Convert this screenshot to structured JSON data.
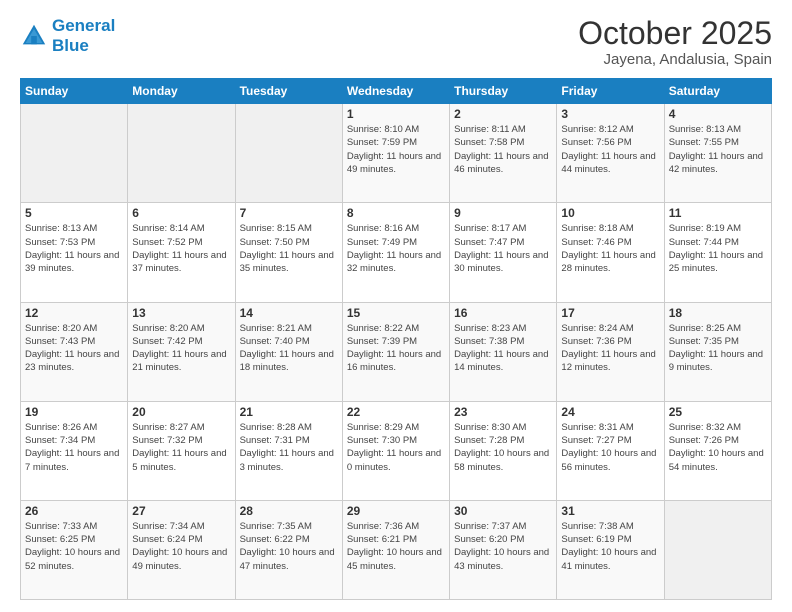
{
  "logo": {
    "line1": "General",
    "line2": "Blue"
  },
  "title": "October 2025",
  "subtitle": "Jayena, Andalusia, Spain",
  "days_of_week": [
    "Sunday",
    "Monday",
    "Tuesday",
    "Wednesday",
    "Thursday",
    "Friday",
    "Saturday"
  ],
  "weeks": [
    [
      {
        "day": "",
        "sunrise": "",
        "sunset": "",
        "daylight": ""
      },
      {
        "day": "",
        "sunrise": "",
        "sunset": "",
        "daylight": ""
      },
      {
        "day": "",
        "sunrise": "",
        "sunset": "",
        "daylight": ""
      },
      {
        "day": "1",
        "sunrise": "Sunrise: 8:10 AM",
        "sunset": "Sunset: 7:59 PM",
        "daylight": "Daylight: 11 hours and 49 minutes."
      },
      {
        "day": "2",
        "sunrise": "Sunrise: 8:11 AM",
        "sunset": "Sunset: 7:58 PM",
        "daylight": "Daylight: 11 hours and 46 minutes."
      },
      {
        "day": "3",
        "sunrise": "Sunrise: 8:12 AM",
        "sunset": "Sunset: 7:56 PM",
        "daylight": "Daylight: 11 hours and 44 minutes."
      },
      {
        "day": "4",
        "sunrise": "Sunrise: 8:13 AM",
        "sunset": "Sunset: 7:55 PM",
        "daylight": "Daylight: 11 hours and 42 minutes."
      }
    ],
    [
      {
        "day": "5",
        "sunrise": "Sunrise: 8:13 AM",
        "sunset": "Sunset: 7:53 PM",
        "daylight": "Daylight: 11 hours and 39 minutes."
      },
      {
        "day": "6",
        "sunrise": "Sunrise: 8:14 AM",
        "sunset": "Sunset: 7:52 PM",
        "daylight": "Daylight: 11 hours and 37 minutes."
      },
      {
        "day": "7",
        "sunrise": "Sunrise: 8:15 AM",
        "sunset": "Sunset: 7:50 PM",
        "daylight": "Daylight: 11 hours and 35 minutes."
      },
      {
        "day": "8",
        "sunrise": "Sunrise: 8:16 AM",
        "sunset": "Sunset: 7:49 PM",
        "daylight": "Daylight: 11 hours and 32 minutes."
      },
      {
        "day": "9",
        "sunrise": "Sunrise: 8:17 AM",
        "sunset": "Sunset: 7:47 PM",
        "daylight": "Daylight: 11 hours and 30 minutes."
      },
      {
        "day": "10",
        "sunrise": "Sunrise: 8:18 AM",
        "sunset": "Sunset: 7:46 PM",
        "daylight": "Daylight: 11 hours and 28 minutes."
      },
      {
        "day": "11",
        "sunrise": "Sunrise: 8:19 AM",
        "sunset": "Sunset: 7:44 PM",
        "daylight": "Daylight: 11 hours and 25 minutes."
      }
    ],
    [
      {
        "day": "12",
        "sunrise": "Sunrise: 8:20 AM",
        "sunset": "Sunset: 7:43 PM",
        "daylight": "Daylight: 11 hours and 23 minutes."
      },
      {
        "day": "13",
        "sunrise": "Sunrise: 8:20 AM",
        "sunset": "Sunset: 7:42 PM",
        "daylight": "Daylight: 11 hours and 21 minutes."
      },
      {
        "day": "14",
        "sunrise": "Sunrise: 8:21 AM",
        "sunset": "Sunset: 7:40 PM",
        "daylight": "Daylight: 11 hours and 18 minutes."
      },
      {
        "day": "15",
        "sunrise": "Sunrise: 8:22 AM",
        "sunset": "Sunset: 7:39 PM",
        "daylight": "Daylight: 11 hours and 16 minutes."
      },
      {
        "day": "16",
        "sunrise": "Sunrise: 8:23 AM",
        "sunset": "Sunset: 7:38 PM",
        "daylight": "Daylight: 11 hours and 14 minutes."
      },
      {
        "day": "17",
        "sunrise": "Sunrise: 8:24 AM",
        "sunset": "Sunset: 7:36 PM",
        "daylight": "Daylight: 11 hours and 12 minutes."
      },
      {
        "day": "18",
        "sunrise": "Sunrise: 8:25 AM",
        "sunset": "Sunset: 7:35 PM",
        "daylight": "Daylight: 11 hours and 9 minutes."
      }
    ],
    [
      {
        "day": "19",
        "sunrise": "Sunrise: 8:26 AM",
        "sunset": "Sunset: 7:34 PM",
        "daylight": "Daylight: 11 hours and 7 minutes."
      },
      {
        "day": "20",
        "sunrise": "Sunrise: 8:27 AM",
        "sunset": "Sunset: 7:32 PM",
        "daylight": "Daylight: 11 hours and 5 minutes."
      },
      {
        "day": "21",
        "sunrise": "Sunrise: 8:28 AM",
        "sunset": "Sunset: 7:31 PM",
        "daylight": "Daylight: 11 hours and 3 minutes."
      },
      {
        "day": "22",
        "sunrise": "Sunrise: 8:29 AM",
        "sunset": "Sunset: 7:30 PM",
        "daylight": "Daylight: 11 hours and 0 minutes."
      },
      {
        "day": "23",
        "sunrise": "Sunrise: 8:30 AM",
        "sunset": "Sunset: 7:28 PM",
        "daylight": "Daylight: 10 hours and 58 minutes."
      },
      {
        "day": "24",
        "sunrise": "Sunrise: 8:31 AM",
        "sunset": "Sunset: 7:27 PM",
        "daylight": "Daylight: 10 hours and 56 minutes."
      },
      {
        "day": "25",
        "sunrise": "Sunrise: 8:32 AM",
        "sunset": "Sunset: 7:26 PM",
        "daylight": "Daylight: 10 hours and 54 minutes."
      }
    ],
    [
      {
        "day": "26",
        "sunrise": "Sunrise: 7:33 AM",
        "sunset": "Sunset: 6:25 PM",
        "daylight": "Daylight: 10 hours and 52 minutes."
      },
      {
        "day": "27",
        "sunrise": "Sunrise: 7:34 AM",
        "sunset": "Sunset: 6:24 PM",
        "daylight": "Daylight: 10 hours and 49 minutes."
      },
      {
        "day": "28",
        "sunrise": "Sunrise: 7:35 AM",
        "sunset": "Sunset: 6:22 PM",
        "daylight": "Daylight: 10 hours and 47 minutes."
      },
      {
        "day": "29",
        "sunrise": "Sunrise: 7:36 AM",
        "sunset": "Sunset: 6:21 PM",
        "daylight": "Daylight: 10 hours and 45 minutes."
      },
      {
        "day": "30",
        "sunrise": "Sunrise: 7:37 AM",
        "sunset": "Sunset: 6:20 PM",
        "daylight": "Daylight: 10 hours and 43 minutes."
      },
      {
        "day": "31",
        "sunrise": "Sunrise: 7:38 AM",
        "sunset": "Sunset: 6:19 PM",
        "daylight": "Daylight: 10 hours and 41 minutes."
      },
      {
        "day": "",
        "sunrise": "",
        "sunset": "",
        "daylight": ""
      }
    ]
  ]
}
